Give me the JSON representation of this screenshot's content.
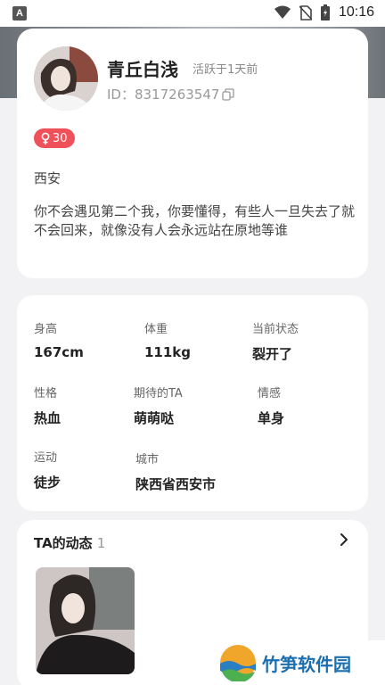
{
  "status_bar": {
    "time": "10:16"
  },
  "profile": {
    "name": "青丘白浅",
    "last_active": "活跃于1天前",
    "id_text": "ID：8317263547",
    "age": "30",
    "city": "西安",
    "bio": "你不会遇见第二个我，你要懂得，有些人一旦失去了就不会回来，就像没有人会永远站在原地等谁"
  },
  "details": {
    "height": {
      "label": "身高",
      "value": "167cm"
    },
    "weight": {
      "label": "体重",
      "value": "111kg"
    },
    "status": {
      "label": "当前状态",
      "value": "裂开了"
    },
    "personality": {
      "label": "性格",
      "value": "热血"
    },
    "expected": {
      "label": "期待的TA",
      "value": "萌萌哒"
    },
    "relationship": {
      "label": "情感",
      "value": "单身"
    },
    "sport": {
      "label": "运动",
      "value": "徒步"
    },
    "location": {
      "label": "城市",
      "value": "陕西省西安市"
    }
  },
  "moments": {
    "title": "TA的动态",
    "count": "1"
  },
  "watermark": {
    "text": "竹笋软件园"
  },
  "colors": {
    "age_badge": "#f0505a",
    "background": "#f2f2f4"
  }
}
